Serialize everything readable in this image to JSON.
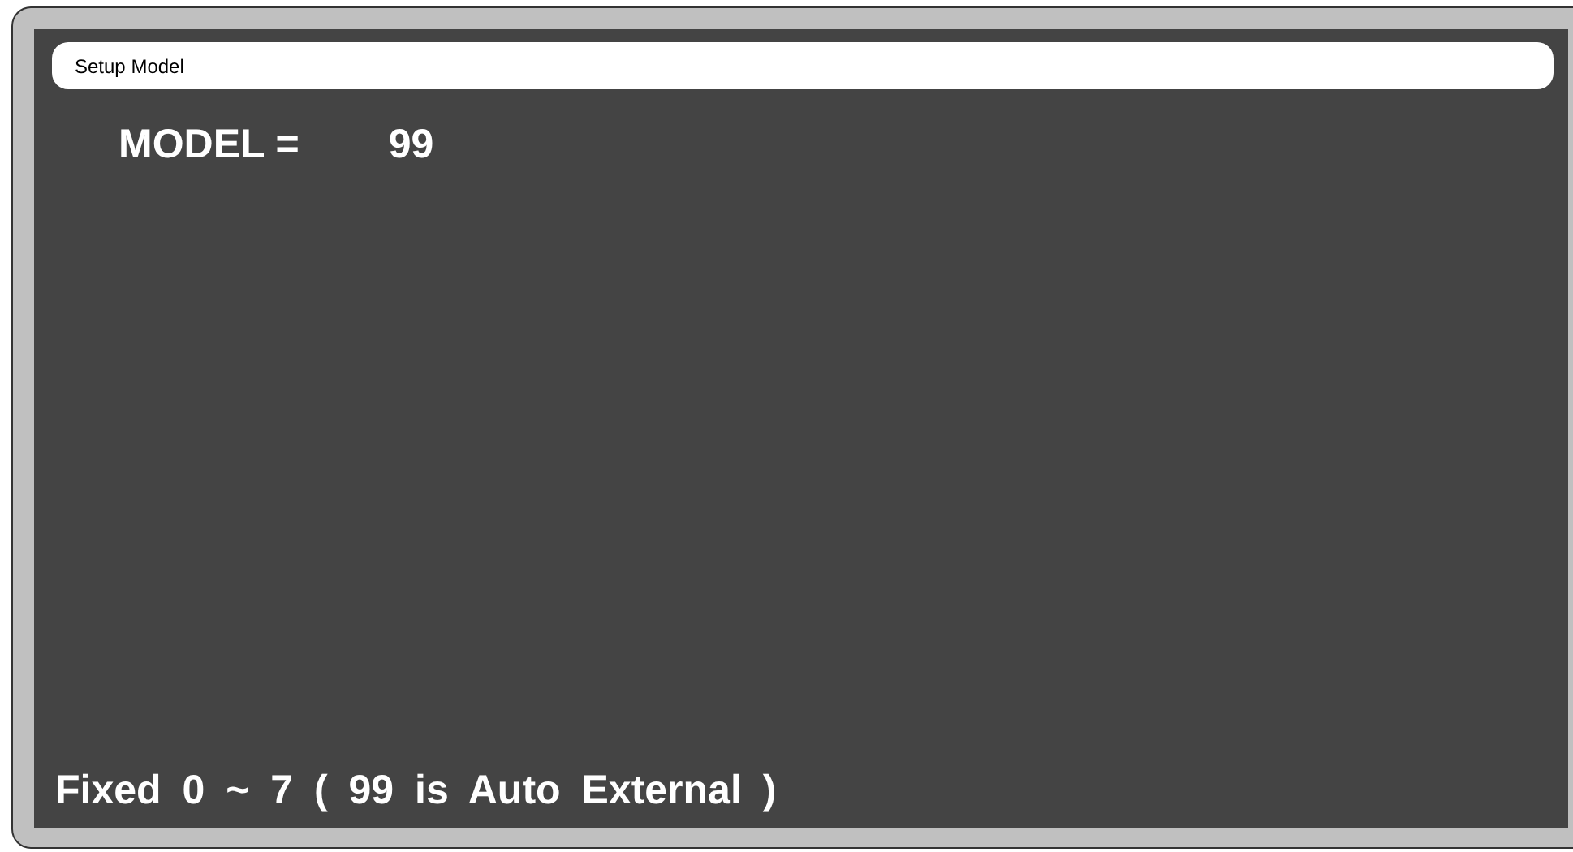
{
  "title_bar": {
    "title": "Setup Model"
  },
  "setting": {
    "label": "MODEL =",
    "value": "99"
  },
  "hint": "Fixed 0 ~ 7 ( 99 is Auto External )"
}
